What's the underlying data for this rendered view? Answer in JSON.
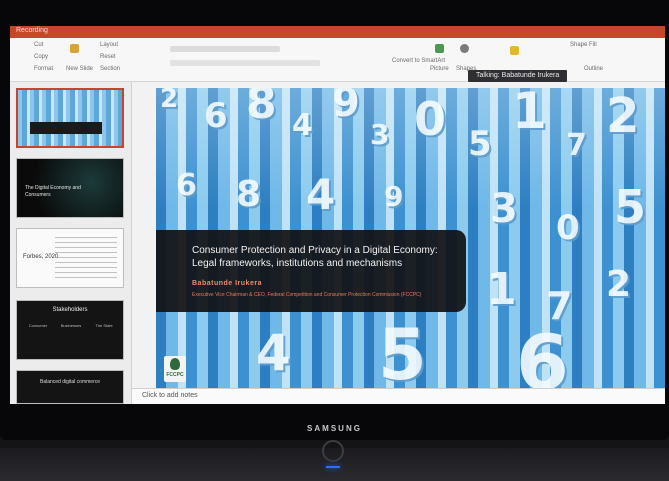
{
  "app": {
    "title": "Recording",
    "ribbon_items": [
      "Cut",
      "Copy",
      "Format",
      "New Slide",
      "Layout",
      "Reset",
      "Section",
      "Convert to SmartArt",
      "Picture",
      "Shapes",
      "Shape Fill",
      "Outline"
    ],
    "talking_indicator": "Talking: Babatunde Irukera"
  },
  "thumbnails": [
    {
      "label": ""
    },
    {
      "label": "The Digital Economy and Consumers"
    },
    {
      "label": "Forbes, 2020"
    },
    {
      "label": "Stakeholders",
      "columns": [
        "Consumer",
        "Businesses",
        "The State"
      ]
    },
    {
      "label": "Balanced digital commerce"
    }
  ],
  "slide": {
    "title": "Consumer Protection and Privacy in a Digital Economy: Legal frameworks, institutions and mechanisms",
    "author": "Babatunde Irukera",
    "role": "Executive Vice Chairman & CEO, Federal Competition and Consumer Protection Commission (FCCPC)",
    "logo_text": "FCCPC",
    "numbers": [
      "2",
      "6",
      "8",
      "4",
      "9",
      "3",
      "0",
      "5",
      "1",
      "7",
      "2",
      "6",
      "8",
      "4",
      "9",
      "3",
      "0",
      "5",
      "1",
      "7",
      "2",
      "5",
      "4",
      "6"
    ]
  },
  "notes_placeholder": "Click to add notes",
  "monitor_brand": "SAMSUNG",
  "colors": {
    "ribbon_accent": "#c7452b",
    "slide_blue": "#3d91d0",
    "caption_bg": "#121214",
    "author": "#f08a6a"
  }
}
